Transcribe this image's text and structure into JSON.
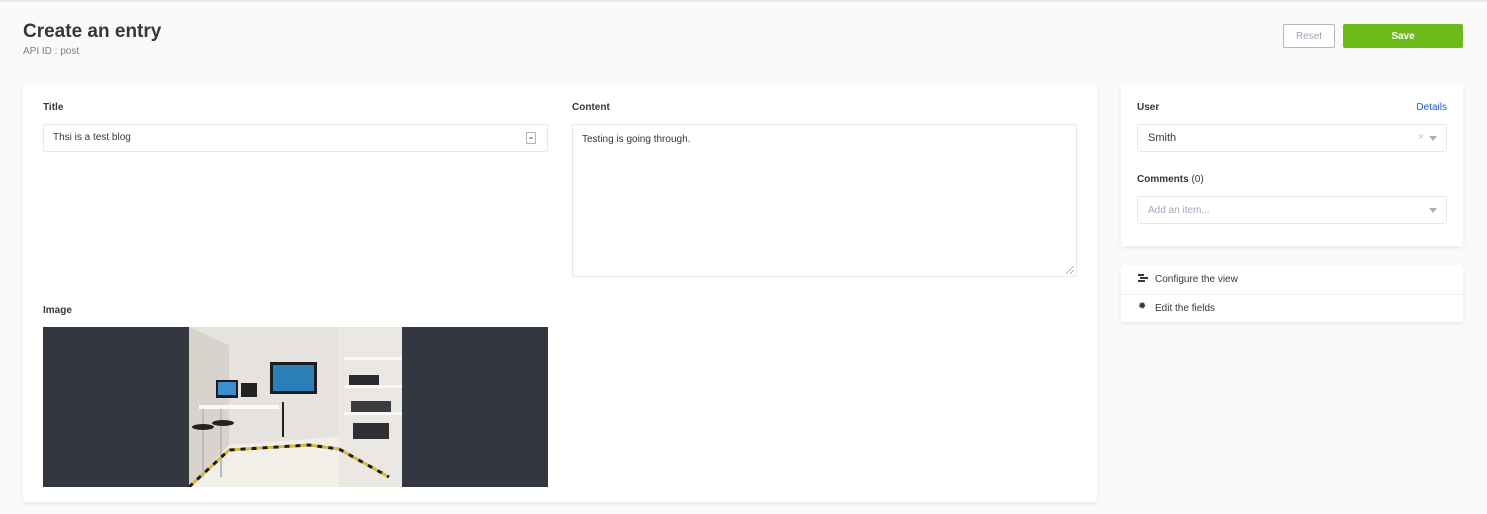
{
  "header": {
    "title": "Create an entry",
    "subtitle": "API ID : post"
  },
  "actions": {
    "reset_label": "Reset",
    "save_label": "Save"
  },
  "form": {
    "title_label": "Title",
    "title_value": "Thsi is a test blog",
    "content_label": "Content",
    "content_value": "Testing is going through.",
    "image_label": "Image"
  },
  "sidebar": {
    "user_label": "User",
    "details_link": "Details",
    "user_value": "Smith",
    "comments_label": "Comments",
    "comments_count": "(0)",
    "comments_placeholder": "Add an item...",
    "menu": [
      {
        "label": "Configure the view",
        "icon": "layout-icon"
      },
      {
        "label": "Edit the fields",
        "icon": "gear-icon"
      }
    ]
  },
  "colors": {
    "save": "#6dbb1a",
    "link": "#1c5de7",
    "image_bg": "#333740"
  }
}
